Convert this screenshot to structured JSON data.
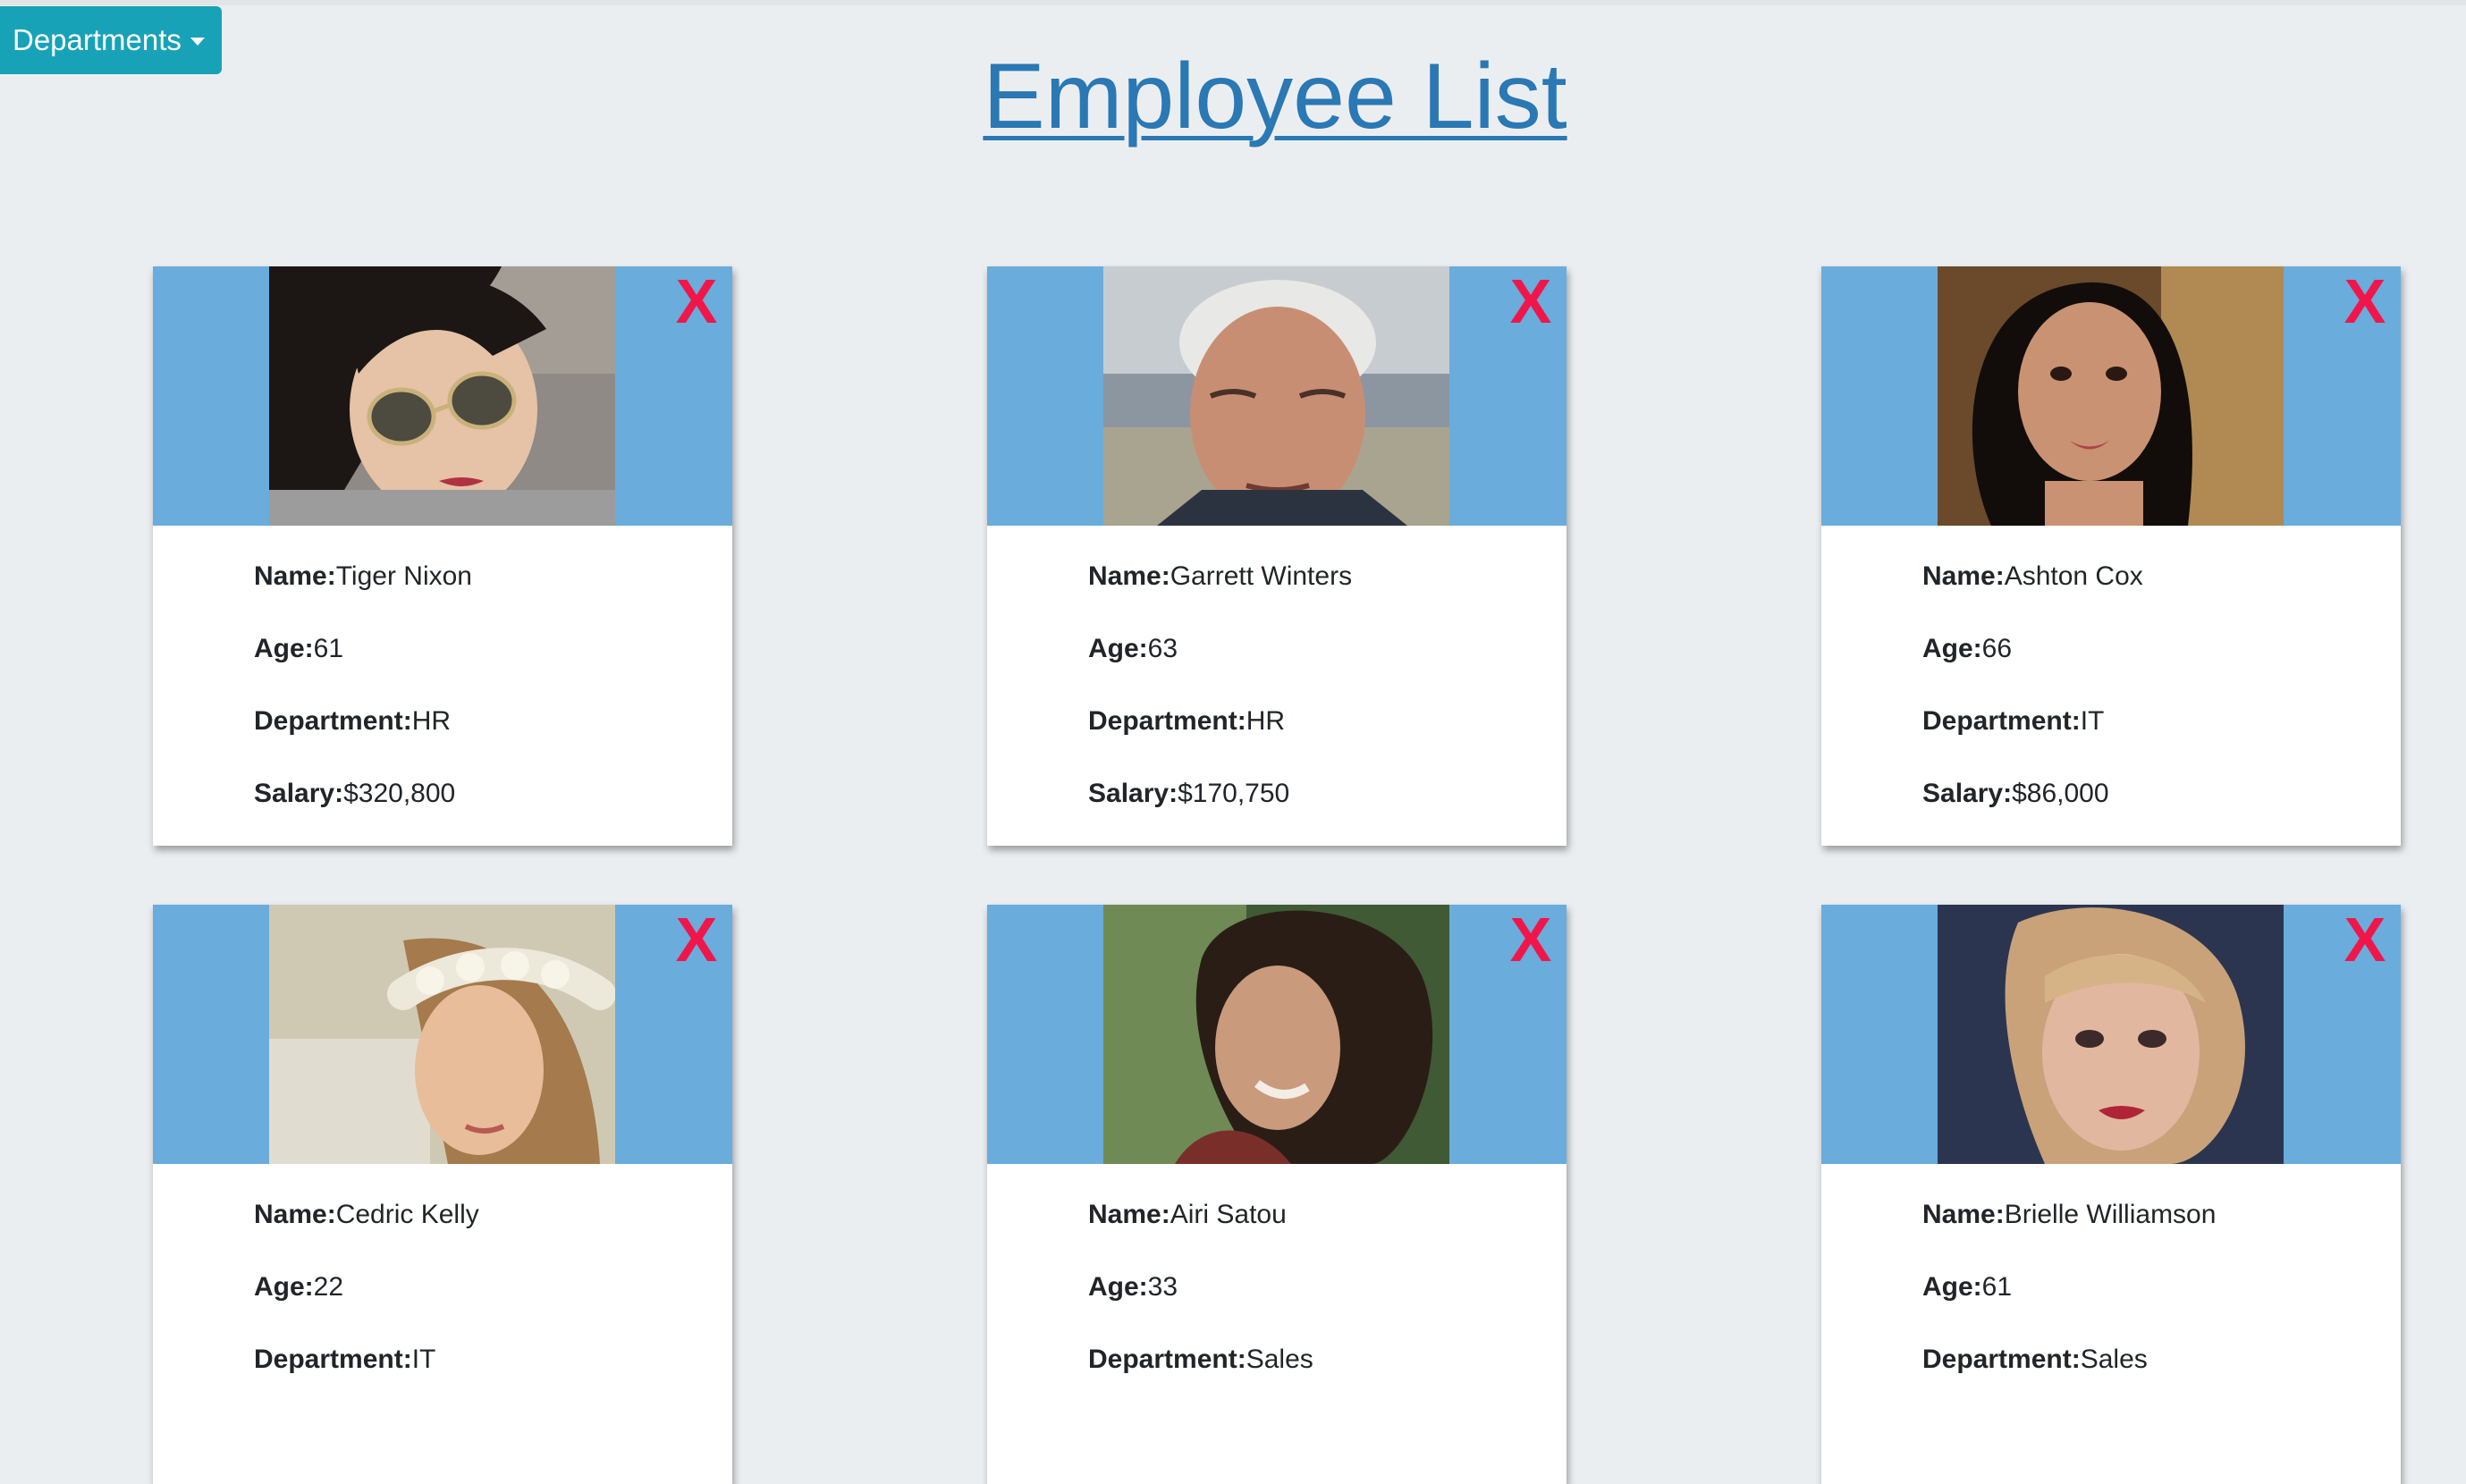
{
  "header": {
    "departments_button": "Departments",
    "title": "Employee List"
  },
  "labels": {
    "name": "Name:",
    "age": "Age:",
    "department": "Department:",
    "salary": "Salary:"
  },
  "remove_label": "X",
  "employees": [
    {
      "name": "Tiger Nixon",
      "age": "61",
      "department": "HR",
      "salary": "$320,800"
    },
    {
      "name": "Garrett Winters",
      "age": "63",
      "department": "HR",
      "salary": "$170,750"
    },
    {
      "name": "Ashton Cox",
      "age": "66",
      "department": "IT",
      "salary": "$86,000"
    },
    {
      "name": "Cedric Kelly",
      "age": "22",
      "department": "IT",
      "salary": ""
    },
    {
      "name": "Airi Satou",
      "age": "33",
      "department": "Sales",
      "salary": ""
    },
    {
      "name": "Brielle Williamson",
      "age": "61",
      "department": "Sales",
      "salary": ""
    }
  ],
  "colors": {
    "background": "#ebeef1",
    "card_header": "#6aacdc",
    "remove_x": "#f0164a",
    "button": "#17a2b8",
    "title_link": "#2a78b4"
  }
}
